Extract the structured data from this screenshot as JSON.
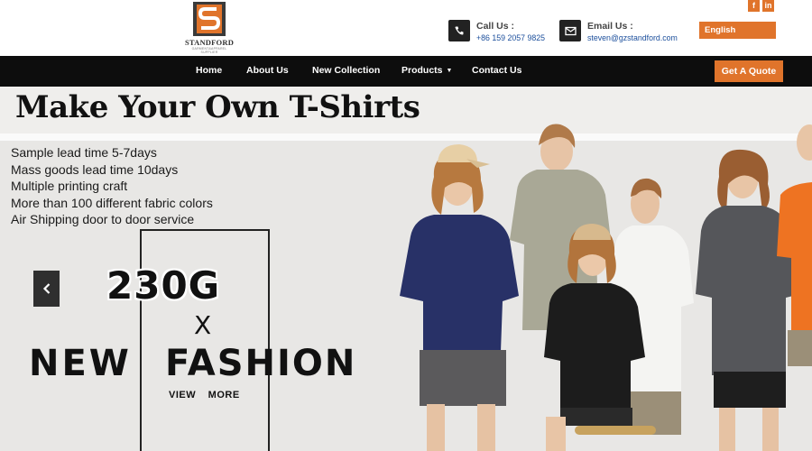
{
  "brand": {
    "name": "STANDFORD",
    "tagline": "GARMENT&APPAREL SUPPLIER",
    "logo_orange": "#e0742b",
    "logo_dark": "#3a3a3a"
  },
  "social": {
    "facebook": "f",
    "linkedin": "in"
  },
  "contact": {
    "call_label": "Call Us :",
    "call_value": "+86 159 2057 9825",
    "email_label": "Email Us :",
    "email_value": "steven@gzstandford.com"
  },
  "language": "English",
  "nav": {
    "home": "Home",
    "about": "About Us",
    "new_collection": "New Collection",
    "products": "Products",
    "contact": "Contact Us",
    "quote": "Get A Quote"
  },
  "hero": {
    "title": "Make Your Own T-Shirts",
    "features": [
      "Sample lead time 5-7days",
      "Mass goods lead time 10days",
      "Multiple printing craft",
      "More than 100 different fabric colors",
      "Air Shipping door to door service"
    ],
    "weight": "230G",
    "cross": "X",
    "new": "NEW",
    "fashion": "FASHION",
    "view_more": "VIEW MORE"
  },
  "colors": {
    "accent": "#e0742b",
    "nav_bg": "#0d0d0d",
    "link": "#1c4f9c"
  }
}
